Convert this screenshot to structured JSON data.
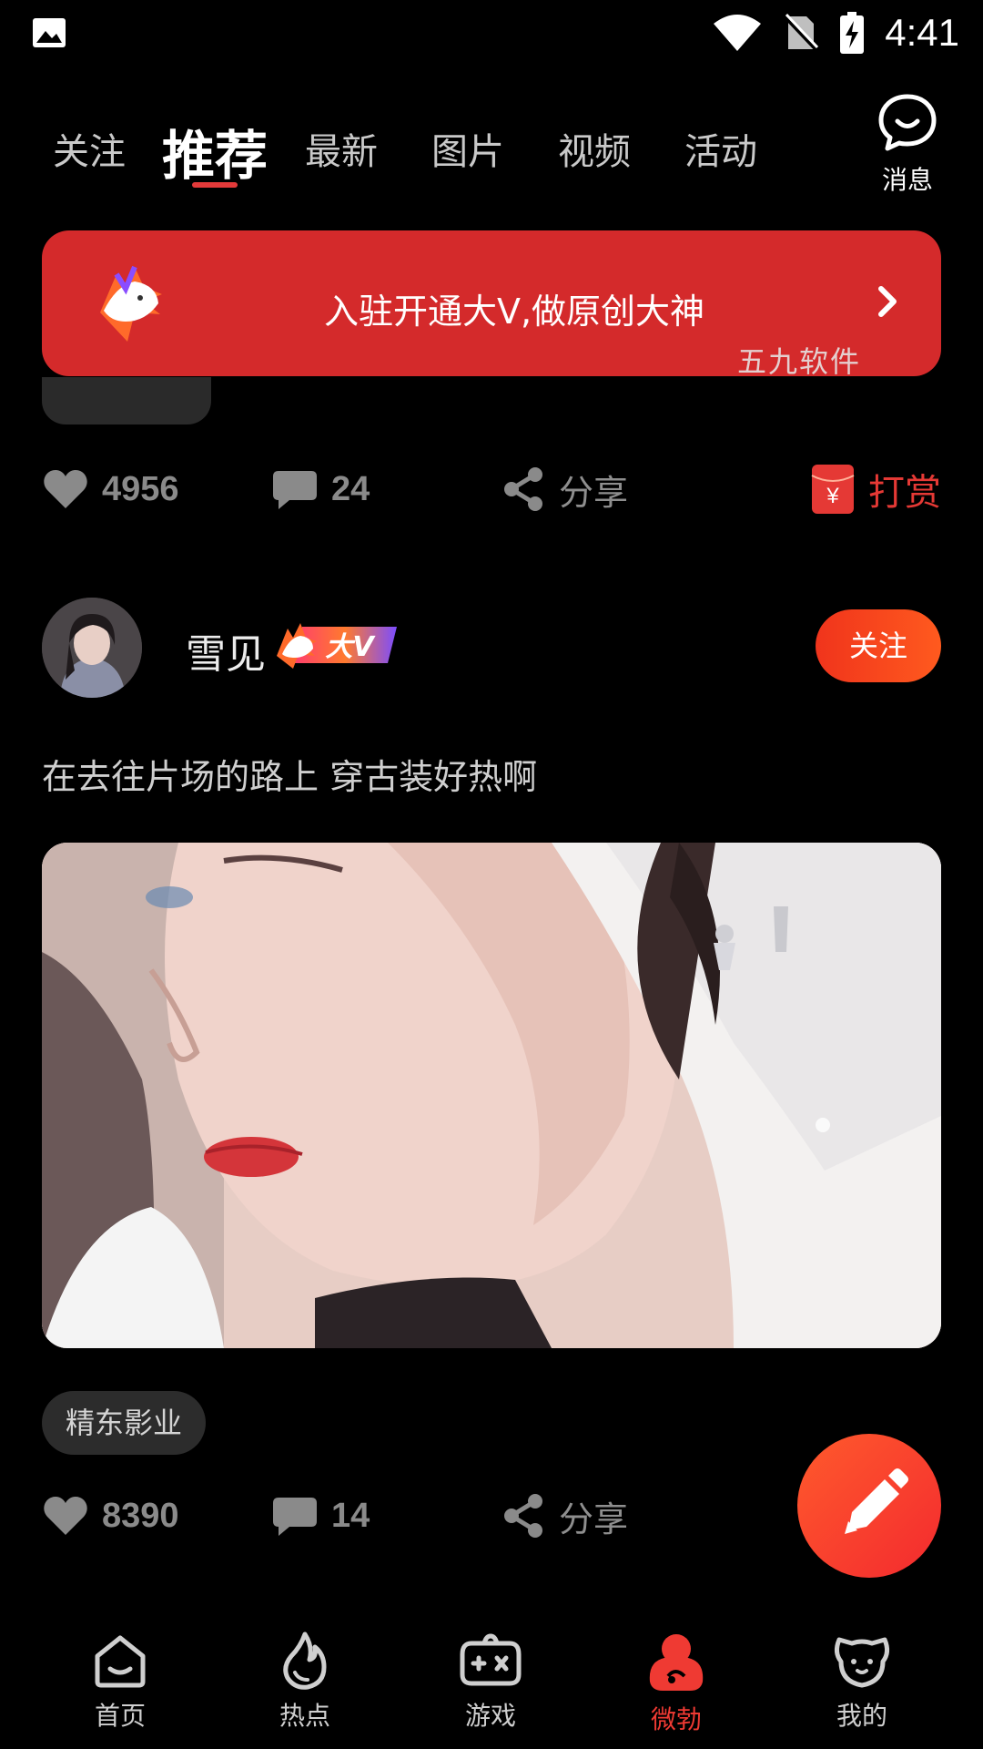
{
  "status_bar": {
    "time": "4:41"
  },
  "tabs": [
    {
      "label": "关注",
      "active": false
    },
    {
      "label": "推荐",
      "active": true
    },
    {
      "label": "最新",
      "active": false
    },
    {
      "label": "图片",
      "active": false
    },
    {
      "label": "视频",
      "active": false
    },
    {
      "label": "活动",
      "active": false
    }
  ],
  "message": {
    "label": "消息"
  },
  "banner": {
    "text": "入驻开通大V,做原创大神"
  },
  "watermark": "五九软件",
  "prev_post": {
    "likes": "4956",
    "comments": "24",
    "share_label": "分享",
    "tip_label": "打赏"
  },
  "post": {
    "author": "雪见",
    "badge": "大V",
    "follow_label": "关注",
    "text": "在去往片场的路上 穿古装好热啊",
    "tag": "精东影业",
    "likes": "8390",
    "comments": "14",
    "share_label": "分享"
  },
  "bottom_nav": [
    {
      "label": "首页",
      "icon": "home-icon",
      "active": false
    },
    {
      "label": "热点",
      "icon": "flame-icon",
      "active": false
    },
    {
      "label": "游戏",
      "icon": "gamepad-icon",
      "active": false
    },
    {
      "label": "微勃",
      "icon": "weibo-icon",
      "active": true
    },
    {
      "label": "我的",
      "icon": "dog-face-icon",
      "active": false
    }
  ],
  "colors": {
    "accent": "#e33a3a",
    "banner": "#d42a2b",
    "follow": "#f0341c"
  }
}
